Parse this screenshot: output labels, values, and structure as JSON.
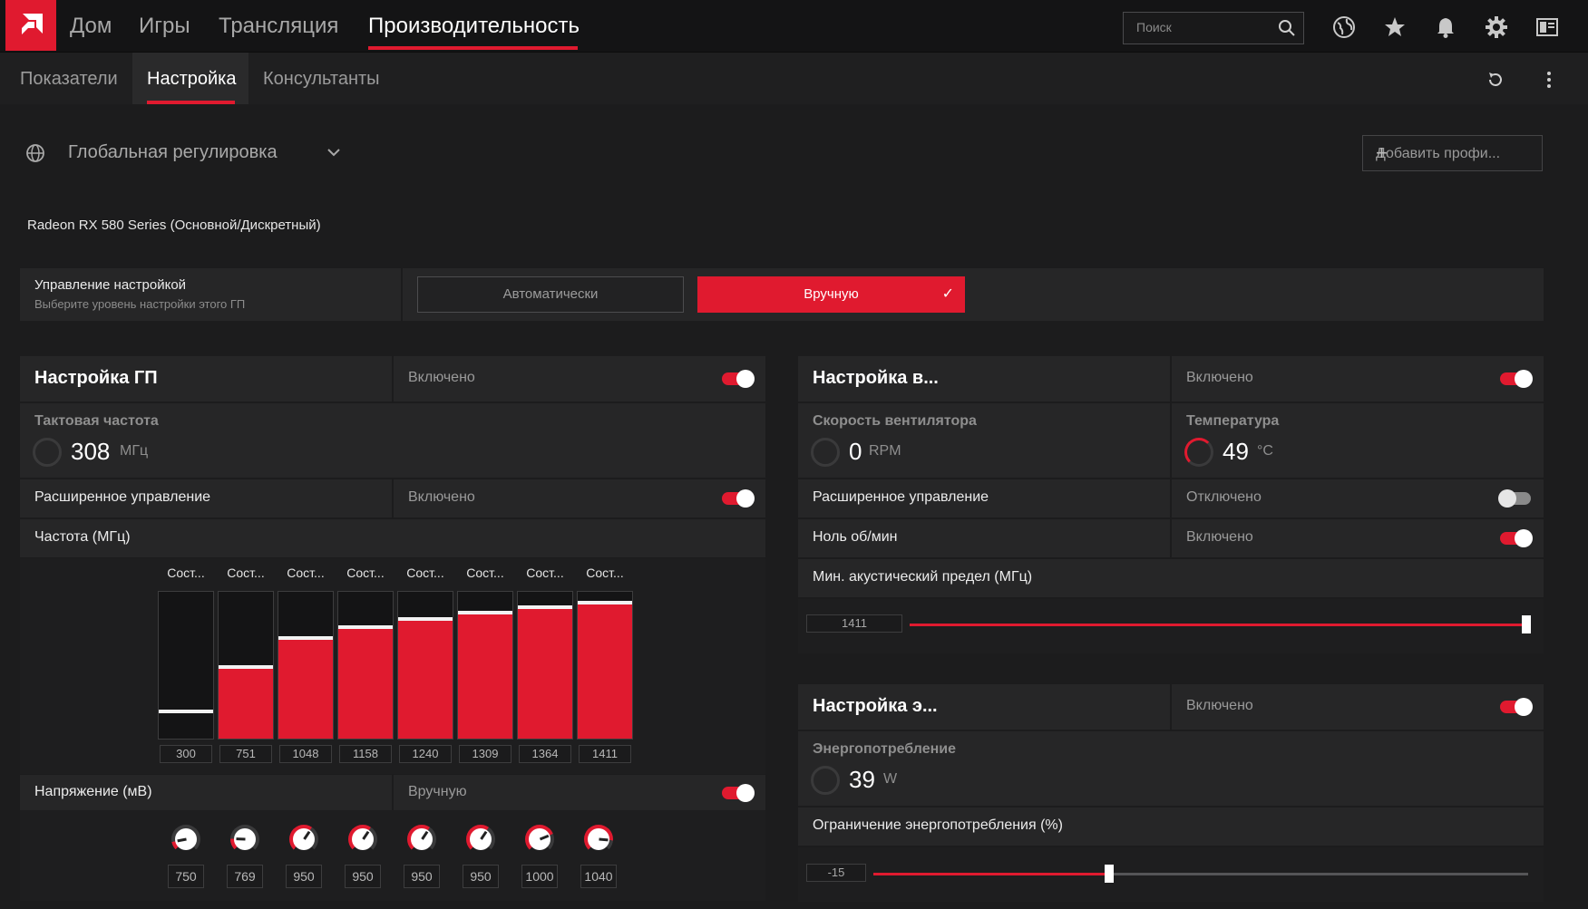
{
  "colors": {
    "accent": "#e01a2f",
    "background": "#1c1c1d",
    "panel": "#262627"
  },
  "topnav": {
    "items": [
      {
        "label": "Дом",
        "icon": "home"
      },
      {
        "label": "Игры",
        "icon": "games"
      },
      {
        "label": "Трансляция",
        "icon": "streaming"
      },
      {
        "label": "Производительность",
        "icon": "performance",
        "active": true
      }
    ],
    "search_placeholder": "Поиск",
    "icons": [
      "web-icon",
      "star-icon",
      "bell-icon",
      "gear-icon",
      "layout-icon"
    ]
  },
  "subtabs": {
    "items": [
      {
        "label": "Показатели"
      },
      {
        "label": "Настройка",
        "active": true
      },
      {
        "label": "Консультанты"
      }
    ]
  },
  "profile": {
    "label": "Глобальная регулировка",
    "add_label": "Добавить профи...",
    "gpu_name": "Radeon RX 580 Series (Основной/Дискретный)"
  },
  "tuning_control": {
    "title": "Управление настройкой",
    "subtitle": "Выберите уровень настройки этого ГП",
    "auto_label": "Автоматически",
    "manual_label": "Вручную",
    "selected": "Вручную"
  },
  "gpu_tuning": {
    "title": "Настройка ГП",
    "status": "Включено",
    "enabled": true,
    "clock": {
      "label": "Тактовая частота",
      "value": "308",
      "unit": "МГц"
    },
    "advanced": {
      "label": "Расширенное управление",
      "status": "Включено",
      "enabled": true
    },
    "frequency": {
      "label": "Частота (МГц)",
      "state_label": "Сост...",
      "values": [
        "300",
        "751",
        "1048",
        "1158",
        "1240",
        "1309",
        "1364",
        "1411"
      ]
    },
    "voltage": {
      "label": "Напряжение (мВ)",
      "status": "Вручную",
      "enabled": true,
      "values": [
        "750",
        "769",
        "950",
        "950",
        "950",
        "950",
        "1000",
        "1040"
      ]
    }
  },
  "fan_tuning": {
    "title": "Настройка в...",
    "status": "Включено",
    "enabled": true,
    "fan_speed": {
      "label": "Скорость вентилятора",
      "value": "0",
      "unit": "RPM"
    },
    "temperature": {
      "label": "Температура",
      "value": "49",
      "unit": "°C"
    },
    "advanced": {
      "label": "Расширенное управление",
      "status": "Отключено",
      "enabled": false
    },
    "zero_rpm": {
      "label": "Ноль об/мин",
      "status": "Включено",
      "enabled": true
    },
    "acoustic": {
      "label": "Мин. акустический предел (МГц)",
      "value": "1411",
      "fraction": 1.0
    }
  },
  "power_tuning": {
    "title": "Настройка э...",
    "status": "Включено",
    "enabled": true,
    "power": {
      "label": "Энергопотребление",
      "value": "39",
      "unit": "W"
    },
    "limit": {
      "label": "Ограничение энергопотребления (%)",
      "value": "-15",
      "fraction": 0.36
    }
  }
}
